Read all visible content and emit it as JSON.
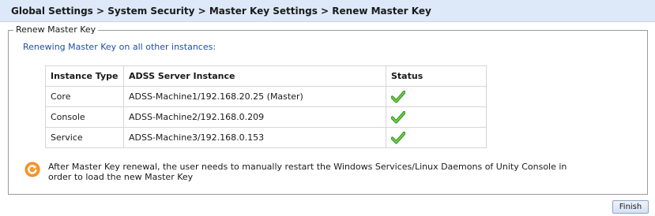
{
  "header": {
    "breadcrumb": "Global Settings > System Security > Master Key Settings > Renew Master Key"
  },
  "panel": {
    "legend": "Renew Master Key",
    "intro": "Renewing Master Key on all other instances:"
  },
  "table": {
    "columns": [
      "Instance Type",
      "ADSS Server Instance",
      "Status"
    ],
    "rows": [
      {
        "type": "Core",
        "instance": "ADSS-Machine1/192.168.20.25 (Master)",
        "status": "check-icon"
      },
      {
        "type": "Console",
        "instance": "ADSS-Machine2/192.168.0.209",
        "status": "check-icon"
      },
      {
        "type": "Service",
        "instance": "ADSS-Machine3/192.168.0.153",
        "status": "check-icon"
      }
    ]
  },
  "note": {
    "icon": "restart-icon",
    "text": "After Master Key renewal, the user needs to manually restart the Windows Services/Linux Daemons of Unity Console in order to load the new Master Key"
  },
  "actions": {
    "finish_label": "Finish"
  },
  "colors": {
    "header_bg": "#dde8f8",
    "intro_text": "#1f4f9a",
    "check_green": "#4caf2a",
    "note_icon_orange": "#f0891f"
  }
}
